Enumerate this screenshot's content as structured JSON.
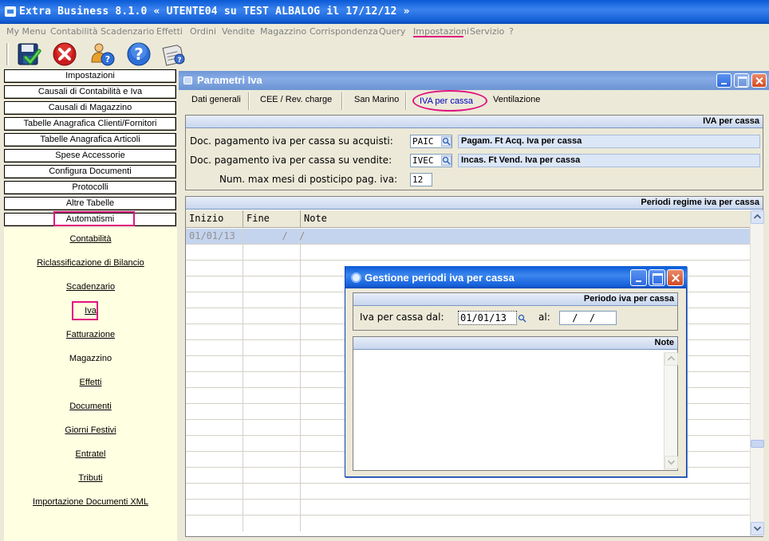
{
  "window": {
    "title": "Extra Business 8.1.0  « UTENTE04 su TEST ALBALOG il 17/12/12 »"
  },
  "menu": {
    "items": [
      "My Menu",
      "Contabilità",
      "Scadenzario",
      "Effetti",
      "Ordini",
      "Vendite",
      "Magazzino",
      "Corrispondenza",
      "Query",
      "Impostazioni",
      "Servizio",
      "?"
    ],
    "active": "Impostazioni"
  },
  "toolbar": {
    "buttons": [
      "save-icon",
      "cancel-icon",
      "user-help-icon",
      "help-icon",
      "notes-icon"
    ]
  },
  "sidebar": {
    "buttons": [
      "Impostazioni",
      "Causali di Contabilità e Iva",
      "Causali di Magazzino",
      "Tabelle Anagrafica Clienti/Fornitori",
      "Tabelle Anagrafica Articoli",
      "Spese Accessorie",
      "Configura Documenti",
      "Protocolli",
      "Altre Tabelle",
      "Automatismi"
    ],
    "selected": "Automatismi",
    "subitems": [
      "Contabilità",
      "Riclassificazione di Bilancio",
      "Scadenzario",
      "Iva",
      "Fatturazione",
      "Magazzino",
      "Effetti",
      "Documenti",
      "Giorni Festivi",
      "Entratel",
      "Tributi",
      "Importazione Documenti XML"
    ],
    "subitem_selected": "Iva"
  },
  "main": {
    "title": "Parametri Iva",
    "tabs": [
      "Dati generali",
      "CEE / Rev. charge",
      "San Marino",
      "IVA per cassa",
      "Ventilazione"
    ],
    "active_tab": "IVA per cassa",
    "iva_section": {
      "heading": "IVA per cassa",
      "rows": [
        {
          "label": "Doc. pagamento iva per cassa su acquisti:",
          "code": "PAIC",
          "description": "Pagam. Ft Acq. Iva per cassa"
        },
        {
          "label": "Doc. pagamento iva per cassa su vendite:",
          "code": "IVEC",
          "description": "Incas. Ft Vend. Iva per cassa"
        }
      ],
      "max_months_label": "Num. max mesi di posticipo pag. iva:",
      "max_months_value": "12"
    },
    "periodi_section": {
      "heading": "Periodi regime iva per cassa",
      "columns": [
        "Inizio",
        "Fine",
        "Note"
      ],
      "rows": [
        {
          "inizio": "01/01/13",
          "fine": "  /  /",
          "note": ""
        }
      ]
    }
  },
  "dialog": {
    "title": "Gestione periodi iva per cassa",
    "periodo_heading": "Periodo iva per cassa",
    "dal_label": "Iva per cassa dal:",
    "dal_value": "01/01/13",
    "al_label": "al:",
    "al_value": " /  /",
    "note_heading": "Note"
  },
  "colors": {
    "highlight": "#e0157f",
    "titlebar": "#0a5ad6",
    "panel_bg": "#ece9d8",
    "subpanel_bg": "#ffffe1",
    "selected_row": "#c5d4ee"
  }
}
